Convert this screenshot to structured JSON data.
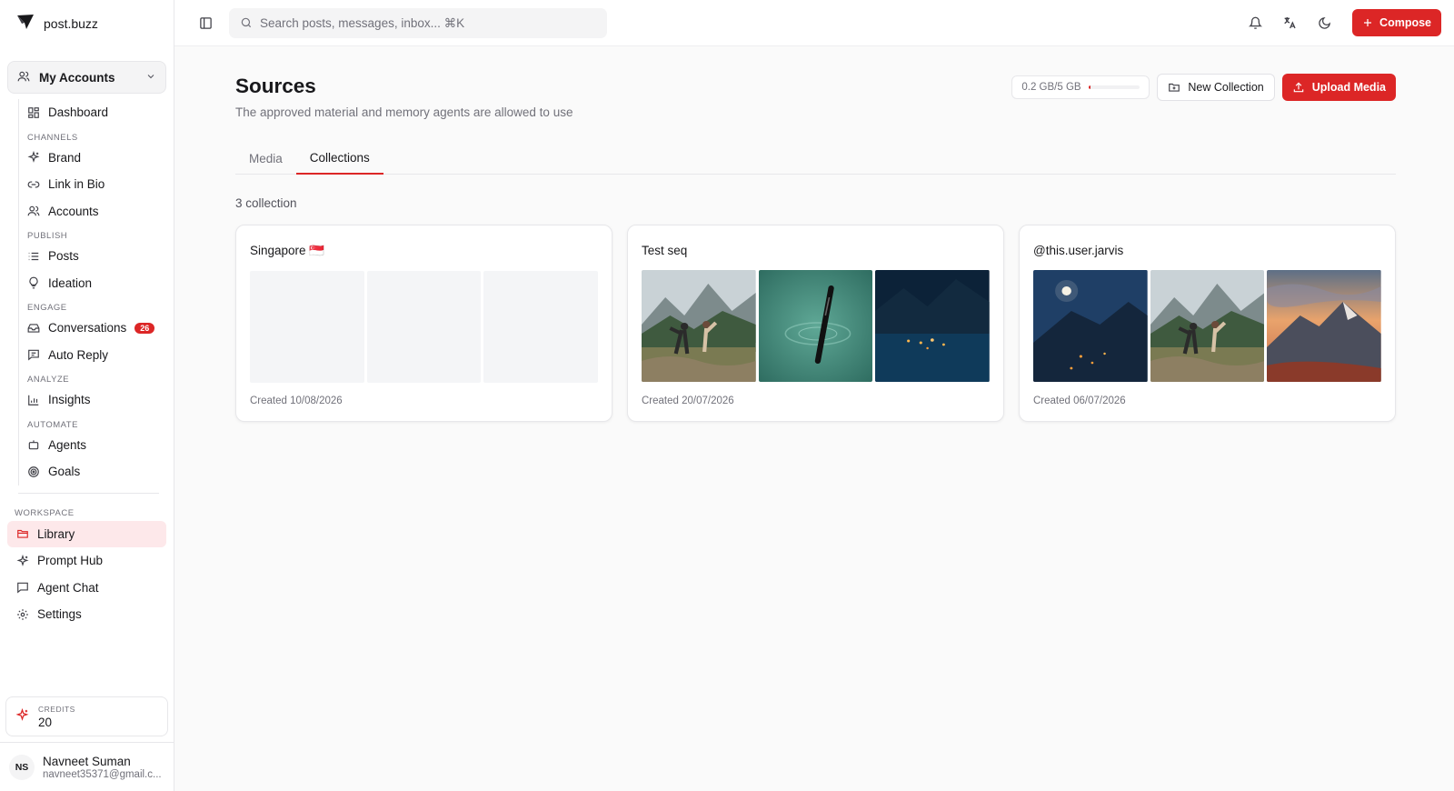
{
  "app": {
    "name": "post.buzz"
  },
  "sidebar": {
    "account_switcher": "My Accounts",
    "dashboard": "Dashboard",
    "sections": [
      {
        "label": "CHANNELS",
        "items": [
          "Brand",
          "Link in Bio",
          "Accounts"
        ]
      },
      {
        "label": "PUBLISH",
        "items": [
          "Posts",
          "Ideation"
        ]
      },
      {
        "label": "ENGAGE",
        "items": [
          "Conversations",
          "Auto Reply"
        ]
      },
      {
        "label": "ANALYZE",
        "items": [
          "Insights"
        ]
      },
      {
        "label": "AUTOMATE",
        "items": [
          "Agents",
          "Goals"
        ]
      }
    ],
    "conversations_badge": "26",
    "workspace_label": "WORKSPACE",
    "workspace_items": [
      "Library",
      "Prompt Hub",
      "Agent Chat",
      "Settings"
    ],
    "credits_label": "CREDITS",
    "credits_value": "20",
    "user": {
      "initials": "NS",
      "name": "Navneet Suman",
      "email": "navneet35371@gmail.c..."
    }
  },
  "topbar": {
    "search_placeholder": "Search posts, messages, inbox... ⌘K",
    "compose_label": "Compose"
  },
  "page": {
    "title": "Sources",
    "subtitle": "The approved material and memory agents are allowed to use",
    "storage_text": "0.2 GB/5 GB",
    "storage_fraction": 0.04,
    "new_collection_label": "New Collection",
    "upload_label": "Upload Media",
    "tabs": [
      "Media",
      "Collections"
    ],
    "active_tab": "Collections",
    "count_text": "3 collection"
  },
  "collections": [
    {
      "title": "Singapore 🇸🇬",
      "created": "Created 10/08/2026",
      "thumbs": [
        "empty",
        "empty",
        "empty"
      ]
    },
    {
      "title": "Test seq",
      "created": "Created 20/07/2026",
      "thumbs": [
        "couple-mountain-meadow",
        "pen-in-water",
        "night-lake-lights"
      ]
    },
    {
      "title": "@this.user.jarvis",
      "created": "Created 06/07/2026",
      "thumbs": [
        "moon-night-mountain",
        "couple-mountain-meadow",
        "sunset-mountain-peak"
      ]
    }
  ],
  "colors": {
    "accent": "#dc2626",
    "active_nav_bg": "#fde8ea"
  }
}
